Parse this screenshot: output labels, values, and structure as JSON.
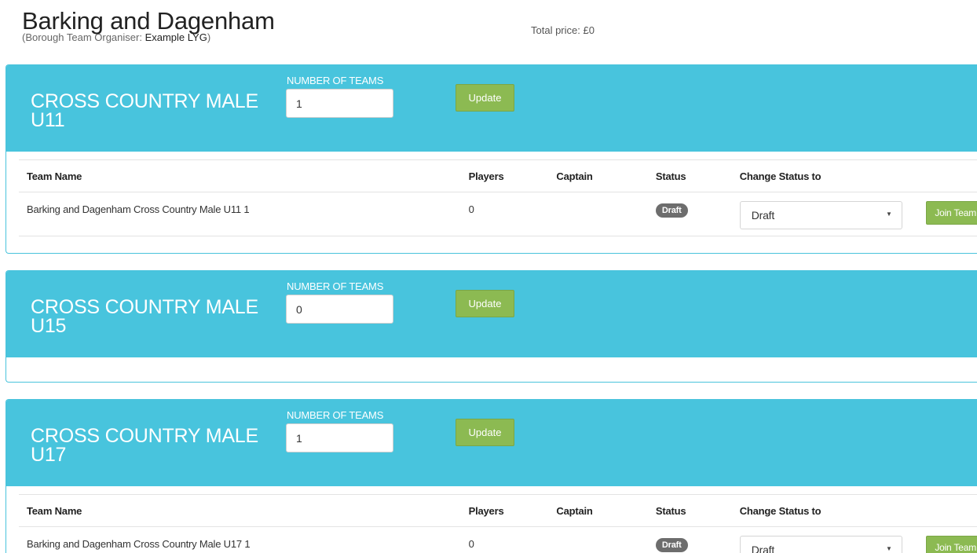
{
  "header": {
    "title": "Barking and Dagenham",
    "organiser_prefix": "(Borough Team Organiser:",
    "organiser_name": "Example LYG",
    "organiser_suffix": ")",
    "total_price": "Total price: £0"
  },
  "table_headers": {
    "team_name": "Team Name",
    "players": "Players",
    "captain": "Captain",
    "status": "Status",
    "change_status": "Change Status to"
  },
  "events": [
    {
      "title": "CROSS COUNTRY MALE U11",
      "teams_label": "NUMBER OF TEAMS",
      "teams_value": "1",
      "update_label": "Update",
      "teams": [
        {
          "name": "Barking and Dagenham Cross Country Male U11 1",
          "players": "0",
          "captain": "",
          "status": "Draft",
          "change_to": "Draft",
          "join_label": "Join Team"
        }
      ]
    },
    {
      "title": "CROSS COUNTRY MALE U15",
      "teams_label": "NUMBER OF TEAMS",
      "teams_value": "0",
      "update_label": "Update",
      "teams": []
    },
    {
      "title": "CROSS COUNTRY MALE U17",
      "teams_label": "NUMBER OF TEAMS",
      "teams_value": "1",
      "update_label": "Update",
      "teams": [
        {
          "name": "Barking and Dagenham Cross Country Male U17 1",
          "players": "0",
          "captain": "",
          "status": "Draft",
          "change_to": "Draft",
          "join_label": "Join Team"
        }
      ]
    }
  ],
  "colors": {
    "panel_header": "#48c4dd",
    "button_green": "#8cba52",
    "badge_grey": "#6d6d6d"
  }
}
